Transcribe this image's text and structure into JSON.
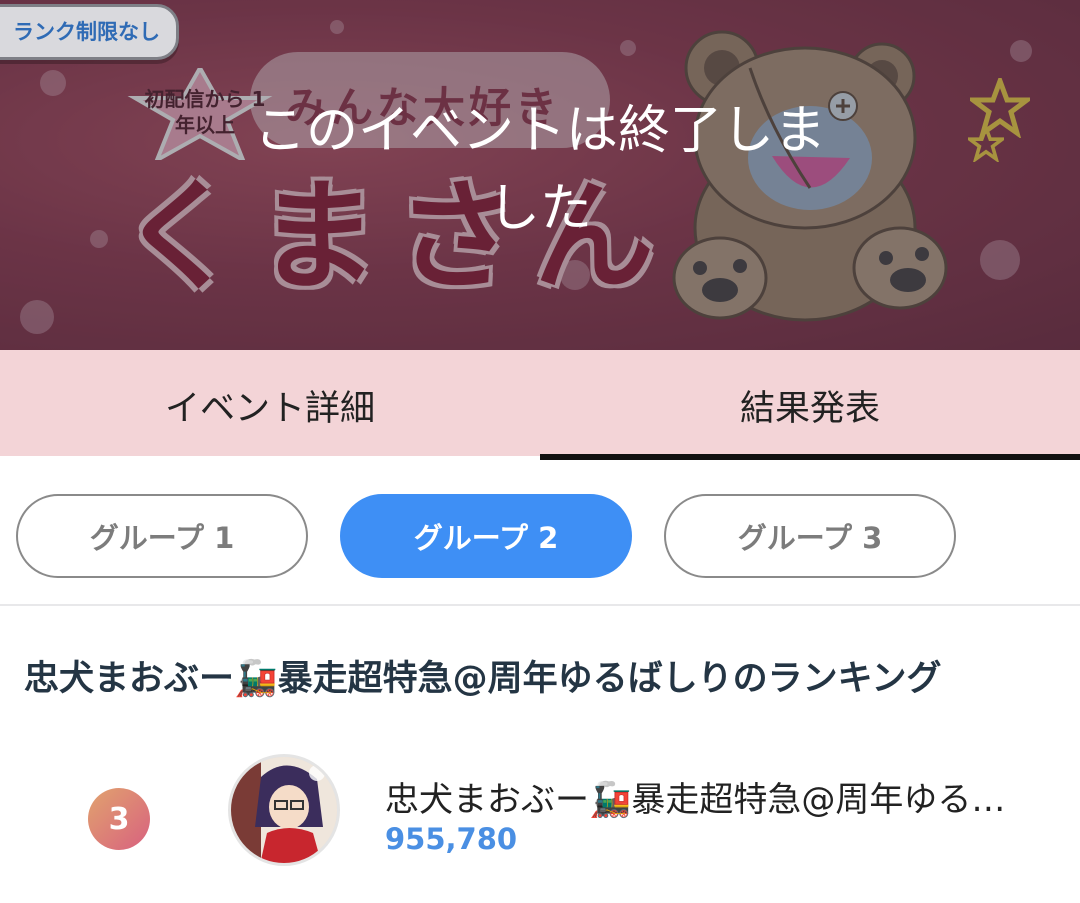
{
  "banner": {
    "rank_tag": "ランク制限なし",
    "badge_text": "初配信から 1年以上",
    "ribbon_text": "みんな大好き",
    "big_title": "くまさん",
    "ended_message": "このイベントは終了しました"
  },
  "tabs": [
    {
      "label": "イベント詳細",
      "selected": false
    },
    {
      "label": "結果発表",
      "selected": true
    }
  ],
  "groups": [
    {
      "label": "グループ 1",
      "selected": false
    },
    {
      "label": "グループ 2",
      "selected": true
    },
    {
      "label": "グループ 3",
      "selected": false
    }
  ],
  "ranking": {
    "heading": "忠犬まおぶー🚂暴走超特急@周年ゆるばしりのランキング",
    "entries": [
      {
        "rank": "3",
        "name": "忠犬まおぶー🚂暴走超特急@周年ゆるばしり",
        "score": "955,780"
      }
    ]
  },
  "colors": {
    "tab_bg": "#f3d4d7",
    "active_pill": "#3e8ff5",
    "score": "#4a8fe3",
    "heading": "#243544"
  }
}
